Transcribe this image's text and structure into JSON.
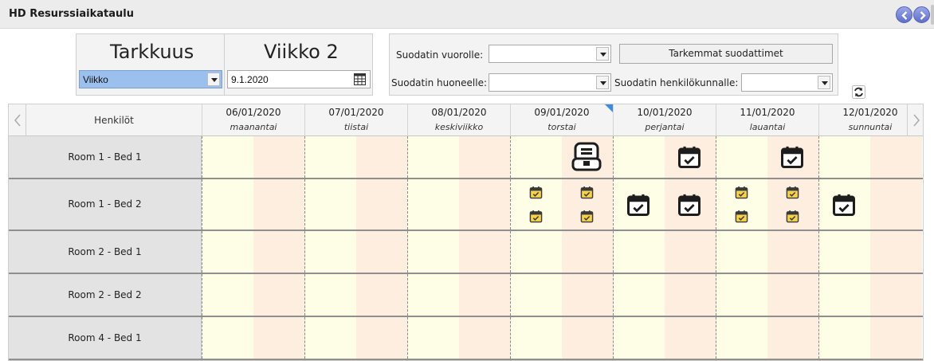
{
  "window": {
    "title": "HD Resurssiaikataulu"
  },
  "granularity": {
    "label": "Tarkkuus",
    "selected": "Viikko"
  },
  "week": {
    "label": "Viikko 2",
    "date": "9.1.2020"
  },
  "filters": {
    "shift_label": "Suodatin vuorolle:",
    "shift_value": "",
    "more_filters_button": "Tarkemmat suodattimet",
    "room_label": "Suodatin huoneelle:",
    "room_value": "",
    "staff_label": "Suodatin henkilökunnalle:",
    "staff_value": ""
  },
  "grid": {
    "people_header": "Henkilöt",
    "days": [
      {
        "date": "06/01/2020",
        "name": "maanantai"
      },
      {
        "date": "07/01/2020",
        "name": "tiistai"
      },
      {
        "date": "08/01/2020",
        "name": "keskiviikko"
      },
      {
        "date": "09/01/2020",
        "name": "torstai"
      },
      {
        "date": "10/01/2020",
        "name": "perjantai"
      },
      {
        "date": "11/01/2020",
        "name": "lauantai"
      },
      {
        "date": "12/01/2020",
        "name": "sunnuntai"
      }
    ],
    "today_index": 3,
    "rows": [
      {
        "label": "Room 1 - Bed 1",
        "events": [
          {
            "day": 3,
            "half": "pm",
            "kind": "machine-icon",
            "size": "large"
          },
          {
            "day": 4,
            "half": "pm",
            "kind": "calendar-check-icon",
            "size": "large"
          },
          {
            "day": 5,
            "half": "pm",
            "kind": "calendar-check-icon",
            "size": "large"
          }
        ]
      },
      {
        "label": "Room 1 - Bed 2",
        "events": [
          {
            "day": 3,
            "half": "am",
            "kind": "calendar-check-icon",
            "size": "small",
            "stack": 2
          },
          {
            "day": 3,
            "half": "pm",
            "kind": "calendar-check-icon",
            "size": "small",
            "stack": 2
          },
          {
            "day": 4,
            "half": "am",
            "kind": "calendar-check-icon",
            "size": "large"
          },
          {
            "day": 4,
            "half": "pm",
            "kind": "calendar-check-icon",
            "size": "large"
          },
          {
            "day": 5,
            "half": "am",
            "kind": "calendar-check-icon",
            "size": "small",
            "stack": 2
          },
          {
            "day": 5,
            "half": "pm",
            "kind": "calendar-check-icon",
            "size": "small",
            "stack": 2
          },
          {
            "day": 6,
            "half": "am",
            "kind": "calendar-check-icon",
            "size": "large"
          }
        ]
      },
      {
        "label": "Room 2 - Bed 1",
        "events": []
      },
      {
        "label": "Room 2 - Bed 2",
        "events": []
      },
      {
        "label": "Room 4 - Bed 1",
        "events": []
      }
    ]
  }
}
